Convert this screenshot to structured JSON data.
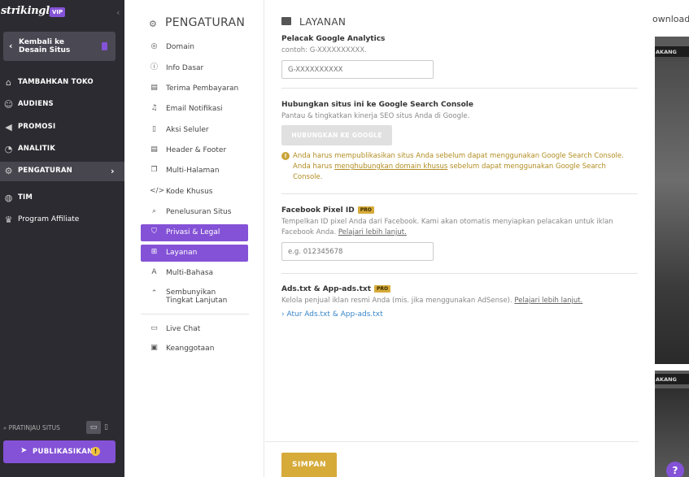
{
  "sidebar": {
    "logo": "strikingly",
    "vip": "VIP",
    "back_label": "Kembali ke Desain Situs",
    "items": [
      {
        "label": "TAMBAHKAN TOKO",
        "icon": "store-icon"
      },
      {
        "label": "AUDIENS",
        "icon": "users-icon"
      },
      {
        "label": "PROMOSI",
        "icon": "megaphone-icon"
      },
      {
        "label": "ANALITIK",
        "icon": "clock-icon"
      },
      {
        "label": "PENGATURAN",
        "icon": "gear-icon"
      },
      {
        "label": "TIM",
        "icon": "team-icon"
      },
      {
        "label": "Program Affiliate",
        "icon": "trophy-icon"
      }
    ],
    "preview_label": "PRATINJAU SITUS",
    "publish_label": "PUBLIKASIKAN",
    "publish_warning": "!"
  },
  "settings_nav": {
    "title": "PENGATURAN",
    "items": [
      {
        "label": "Domain",
        "icon": "globe-icon"
      },
      {
        "label": "Info Dasar",
        "icon": "info-icon"
      },
      {
        "label": "Terima Pembayaran",
        "icon": "payment-icon"
      },
      {
        "label": "Email Notifikasi",
        "icon": "bell-icon"
      },
      {
        "label": "Aksi Seluler",
        "icon": "mobile-icon"
      },
      {
        "label": "Header & Footer",
        "icon": "layout-icon"
      },
      {
        "label": "Multi-Halaman",
        "icon": "pages-icon"
      },
      {
        "label": "Kode Khusus",
        "icon": "code-icon"
      },
      {
        "label": "Penelusuran Situs",
        "icon": "search-icon"
      },
      {
        "label": "Privasi & Legal",
        "icon": "shield-icon"
      },
      {
        "label": "Layanan",
        "icon": "grid-icon"
      },
      {
        "label": "Multi-Bahasa",
        "icon": "translate-icon"
      },
      {
        "label": "Sembunyikan Tingkat Lanjutan",
        "icon": "chevron-up-icon"
      },
      {
        "label": "Live Chat",
        "icon": "chat-icon"
      },
      {
        "label": "Keanggotaan",
        "icon": "member-icon"
      }
    ]
  },
  "content": {
    "title": "LAYANAN",
    "ga": {
      "label": "Pelacak Google Analytics",
      "hint": "contoh: G-XXXXXXXXXX.",
      "placeholder": "G-XXXXXXXXXX"
    },
    "gsc": {
      "label": "Hubungkan situs ini ke Google Search Console",
      "desc": "Pantau & tingkatkan kinerja SEO situs Anda di Google.",
      "button": "HUBUNGKAN KE GOOGLE",
      "warn_a": "Anda harus mempublikasikan situs Anda sebelum dapat menggunakan Google Search Console. Anda harus ",
      "warn_link": "menghubungkan domain khusus",
      "warn_b": " sebelum dapat menggunakan Google Search Console."
    },
    "fb": {
      "label": "Facebook Pixel ID",
      "pro": "PRO",
      "desc": "Tempelkan ID pixel Anda dari Facebook. Kami akan otomatis menyiapkan pelacakan untuk iklan Facebook Anda. ",
      "link": "Pelajari lebih lanjut.",
      "placeholder": "e.g. 012345678"
    },
    "ads": {
      "label": "Ads.txt & App-ads.txt",
      "pro": "PRO",
      "desc": "Kelola penjual iklan resmi Anda (mis. jika menggunakan AdSense). ",
      "link": "Pelajari lebih lanjut.",
      "action": "› Atur Ads.txt & App-ads.txt"
    },
    "save": "SIMPAN"
  },
  "preview": {
    "download_text": "ownload",
    "bar_text": "AKANG",
    "help": "?"
  }
}
